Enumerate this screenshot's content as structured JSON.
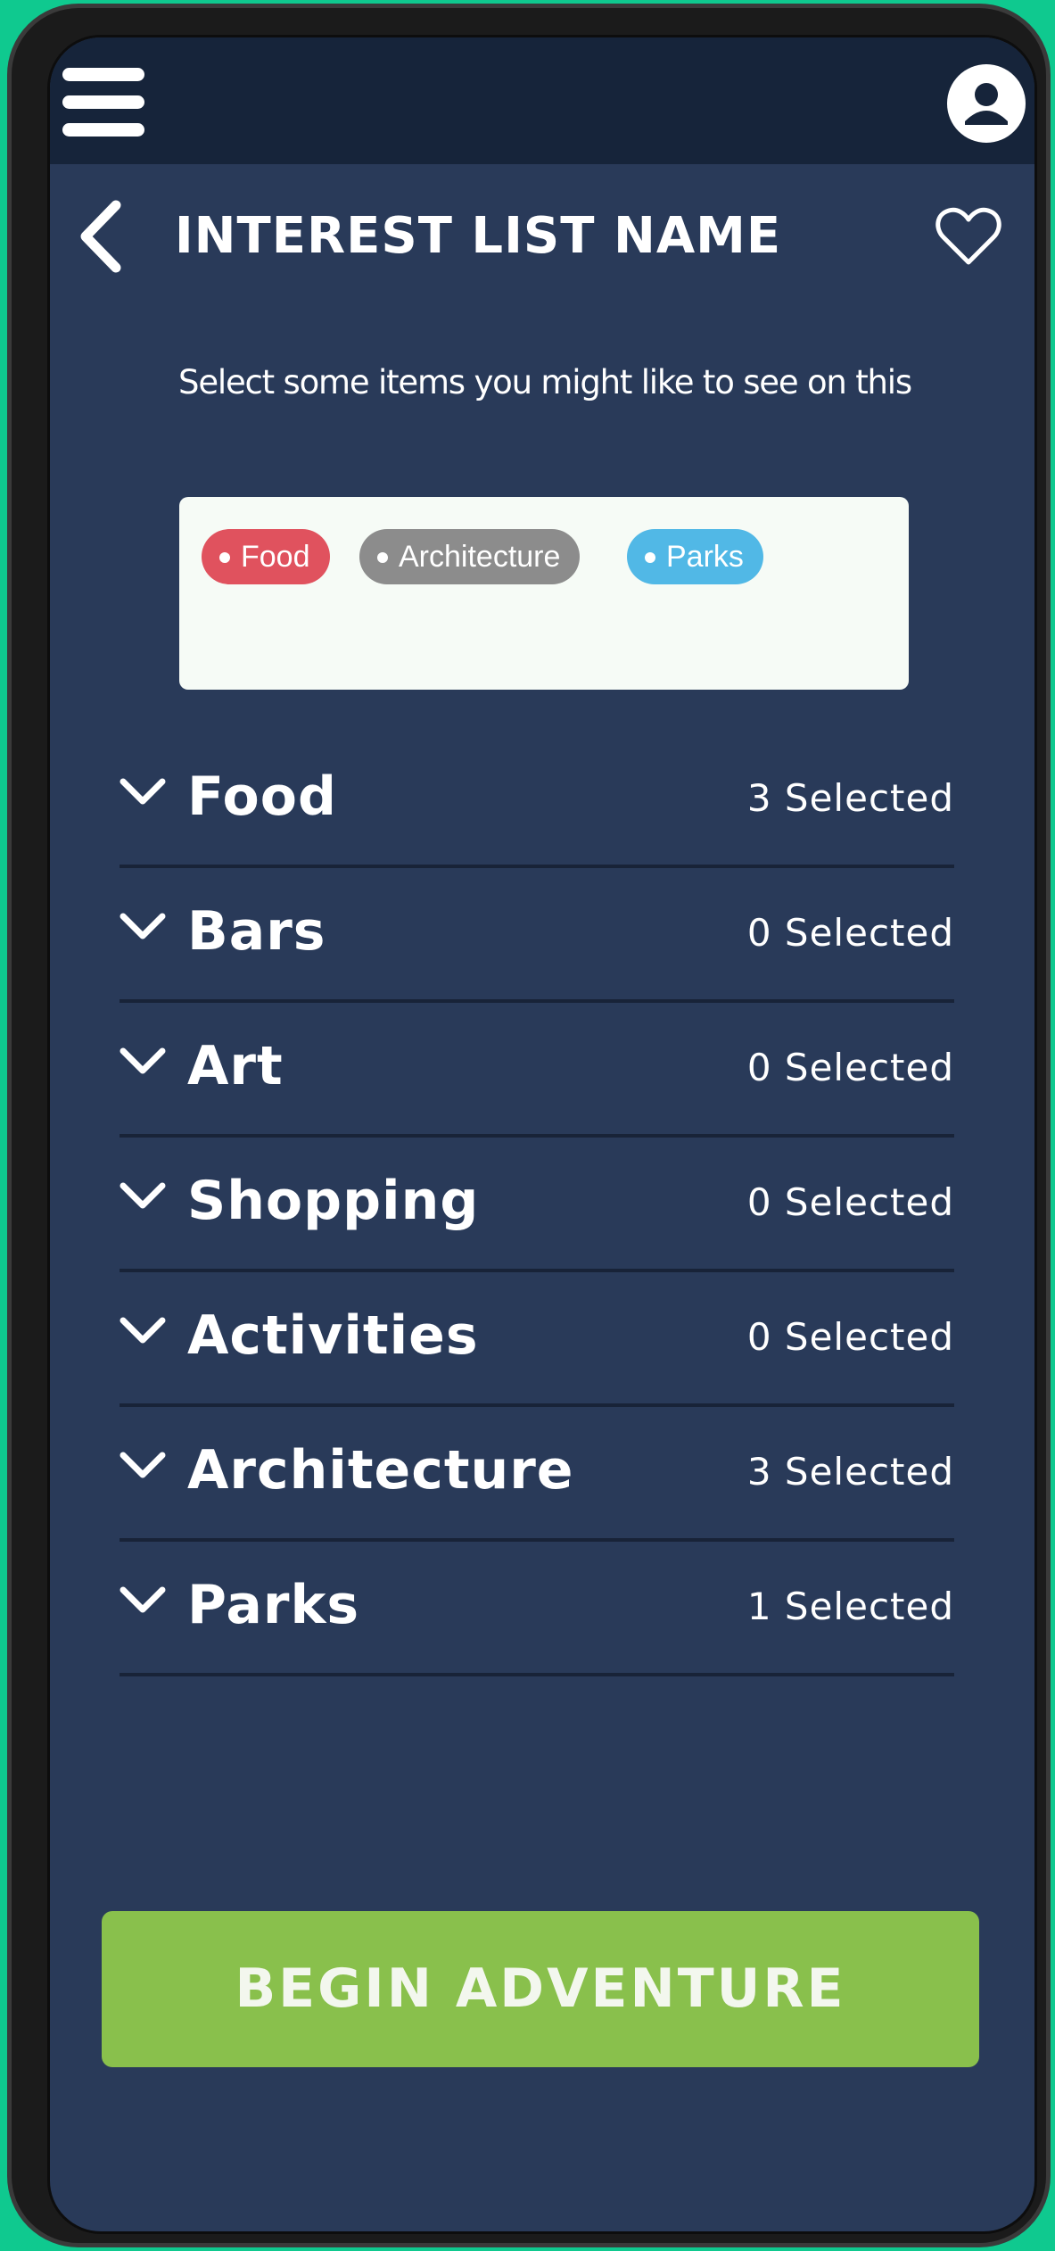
{
  "header": {
    "title": "INTEREST LIST NAME",
    "subtitle": "Select some items you might like to see on this"
  },
  "selected_tags": [
    {
      "label": "Food",
      "color": "#e0525e"
    },
    {
      "label": "Architecture",
      "color": "#8c8c8c"
    },
    {
      "label": "Parks",
      "color": "#51b8e6"
    }
  ],
  "categories": [
    {
      "name": "Food",
      "count": "3 Selected"
    },
    {
      "name": "Bars",
      "count": "0 Selected"
    },
    {
      "name": "Art",
      "count": "0 Selected"
    },
    {
      "name": "Shopping",
      "count": "0 Selected"
    },
    {
      "name": "Activities",
      "count": "0 Selected"
    },
    {
      "name": "Architecture",
      "count": "3 Selected"
    },
    {
      "name": "Parks",
      "count": "1 Selected"
    }
  ],
  "cta": {
    "label": "BEGIN ADVENTURE"
  },
  "icons": {
    "menu": "hamburger-menu-icon",
    "profile": "user-avatar-icon",
    "back": "chevron-left-icon",
    "favorite": "heart-outline-icon",
    "expand": "chevron-down-icon"
  },
  "colors": {
    "background": "#293a59",
    "topbar": "#16243a",
    "accent": "#89c04c"
  }
}
